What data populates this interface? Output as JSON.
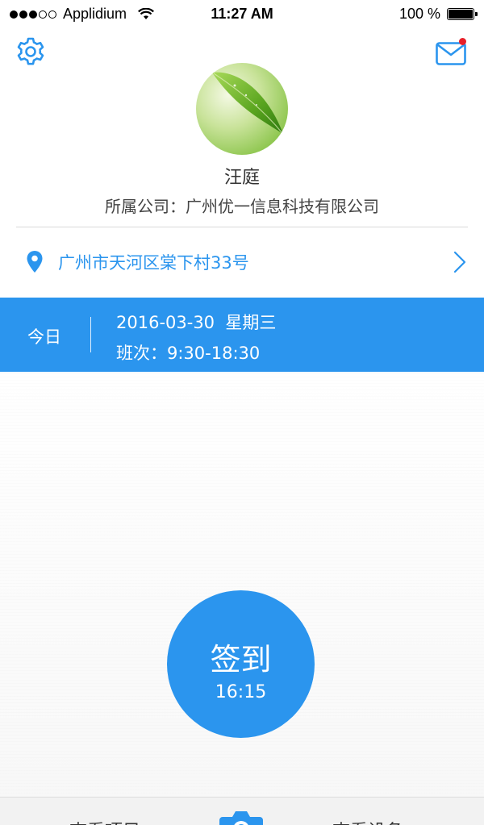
{
  "status_bar": {
    "carrier": "Applidium",
    "time": "11:27 AM",
    "battery_text": "100 %",
    "battery_level": 1.0
  },
  "header": {
    "settings_icon": "gear-icon",
    "mail_icon": "envelope-icon",
    "mail_badge": true
  },
  "profile": {
    "name": "汪庭",
    "company": "所属公司：广州优一信息科技有限公司"
  },
  "location": {
    "address": "广州市天河区棠下村33号"
  },
  "today": {
    "label": "今日",
    "date": "2016-03-30  星期三",
    "shift": "班次：9:30-18:30"
  },
  "checkin": {
    "label": "签到",
    "time": "16:15"
  },
  "tab_bar": {
    "left_label": "查看项目",
    "right_label": "查看设备"
  },
  "colors": {
    "accent": "#2b95ee",
    "badge": "#e8202a"
  }
}
